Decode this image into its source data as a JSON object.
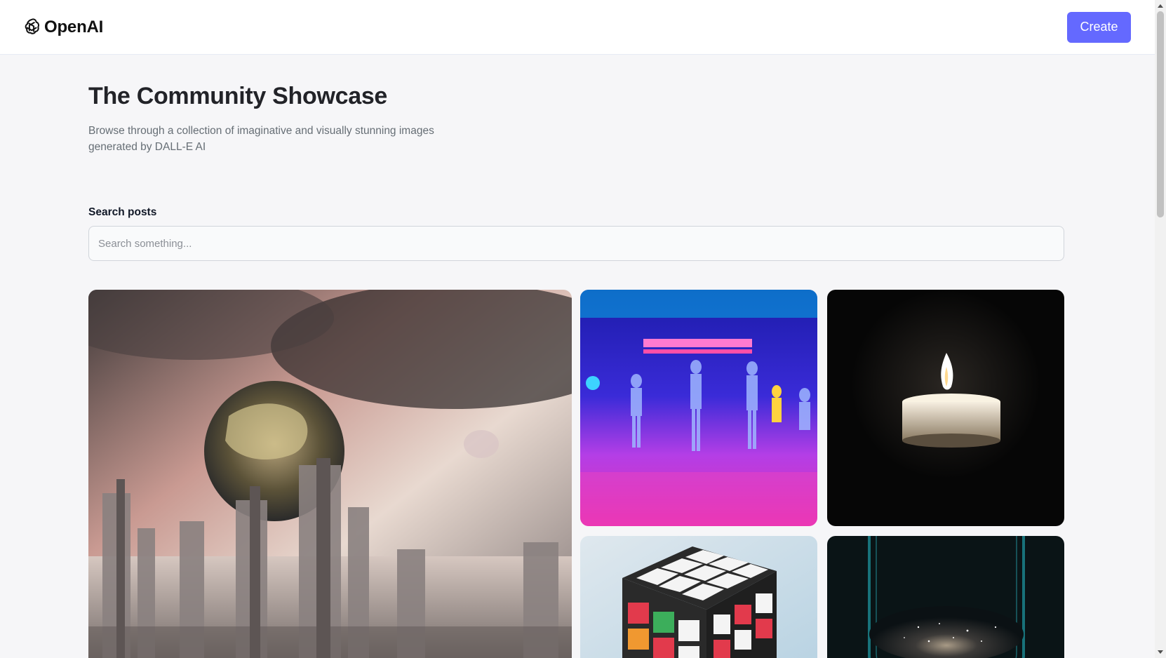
{
  "header": {
    "logo_text": "OpenAI",
    "logo_icon": "openai-knot-icon",
    "create_label": "Create",
    "accent_color": "#6469ff"
  },
  "main": {
    "title": "The Community Showcase",
    "subtitle": "Browse through a collection of imaginative and visually stunning images generated by DALL-E AI",
    "search": {
      "label": "Search posts",
      "placeholder": "Search something...",
      "value": ""
    }
  },
  "gallery": {
    "cards": [
      {
        "name": "post-image-apocalyptic-city"
      },
      {
        "name": "post-image-neon-dancers"
      },
      {
        "name": "post-image-candle"
      },
      {
        "name": "post-image-rubiks-cube"
      },
      {
        "name": "post-image-galaxy-glass"
      }
    ]
  }
}
